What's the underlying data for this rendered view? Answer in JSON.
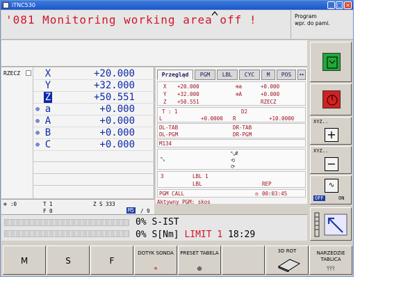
{
  "window": {
    "title": "iTNC530"
  },
  "message": {
    "text": "'081 Monitoring working area off !"
  },
  "mode_box": {
    "line1": "Program",
    "line2": "wpr. do pami."
  },
  "position": {
    "mode": "RZECZ",
    "axes": [
      {
        "name": "X",
        "value": "+20.000",
        "marker": ""
      },
      {
        "name": "Y",
        "value": "+32.000",
        "marker": ""
      },
      {
        "name": "Z",
        "value": "+50.551",
        "marker": ""
      },
      {
        "name": "a",
        "value": "+0.000",
        "marker": "⊕"
      },
      {
        "name": "A",
        "value": "+0.000",
        "marker": "⊕"
      },
      {
        "name": "B",
        "value": "+0.000",
        "marker": "⊕"
      },
      {
        "name": "C",
        "value": "+0.000",
        "marker": "⊕"
      }
    ]
  },
  "status": {
    "tabs": [
      "Przegląd",
      "PGM",
      "LBL",
      "CYC",
      "M",
      "POS"
    ],
    "coords": [
      {
        "a": "X",
        "av": "+20.000",
        "b": "⊕a",
        "bv": "+0.000"
      },
      {
        "a": "Y",
        "av": "+32.000",
        "b": "⊕A",
        "bv": "+0.000"
      },
      {
        "a": "Z",
        "av": "+50.551",
        "b": "",
        "bv": "RZECZ"
      }
    ],
    "tool_t": "T : 1",
    "tool_d2": "D2",
    "tool_l": "L",
    "tool_lv": "+0.0000",
    "tool_r": "R",
    "tool_rv": "+10.0000",
    "dl_tab": "DL-TAB",
    "dr_tab": "DR-TAB",
    "dl_pgm": "DL-PGM",
    "dr_pgm": "DR-PGM",
    "m_func": "M134",
    "lbl_num": "3",
    "lbl1": "LBL 1",
    "lbl2": "LBL",
    "rep": "REP",
    "pgm_call": "PGM CALL",
    "time": "00:03:45",
    "active_pgm": "Aktywny PGM: skos"
  },
  "info": {
    "left": ":0",
    "t": "T  1",
    "z": "Z  S 333",
    "f": "F  0",
    "m": "M5",
    "m2": "/ 9"
  },
  "feed": {
    "line1_pct": "0%",
    "line1_label": "S-IST",
    "line2_pct": "0%",
    "line2_label": "S[Nm]",
    "limit": "LIMIT 1",
    "clock": "18:29"
  },
  "vsoftkeys": {
    "xyz1": "XYZ..",
    "xyz2": "XYZ..",
    "off": "OFF",
    "on": "ON"
  },
  "softkeys": {
    "m": "M",
    "s": "S",
    "f": "F",
    "touch": "DOTYK SONDA",
    "preset": "PRESET TABELA",
    "rot": "3D ROT",
    "tool": "NARZEDZIE TABLICA"
  },
  "colors": {
    "message_red": "#d4142a",
    "axis_blue": "#0c2aa8",
    "status_red": "#a0101c"
  }
}
